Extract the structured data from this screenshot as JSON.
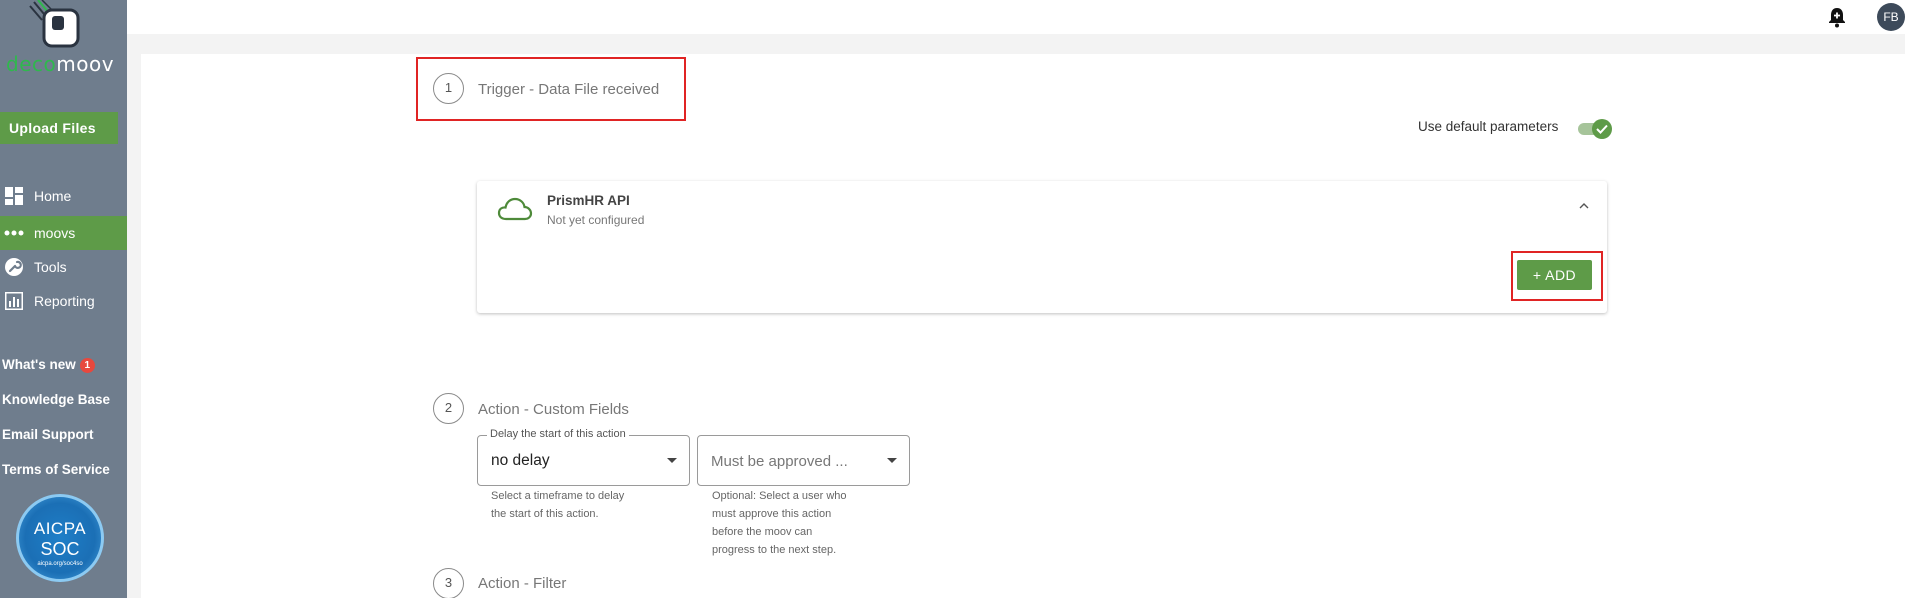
{
  "app": {
    "logo_part1": "deco",
    "logo_part2": "moov"
  },
  "sidebar": {
    "upload_label": "Upload Files",
    "nav": [
      {
        "label": "Home",
        "icon": "dashboard-icon"
      },
      {
        "label": "moovs",
        "icon": "dots-icon",
        "active": true
      },
      {
        "label": "Tools",
        "icon": "wrench-icon"
      },
      {
        "label": "Reporting",
        "icon": "bar-chart-icon"
      }
    ],
    "links": {
      "whats_new": "What's new",
      "whats_new_badge": "1",
      "knowledge_base": "Knowledge Base",
      "email_support": "Email Support",
      "terms": "Terms of Service"
    },
    "badge": {
      "line1": "AICPA",
      "line2": "SOC",
      "line3": "aicpa.org/soc4so"
    }
  },
  "topbar": {
    "avatar_initials": "FB"
  },
  "steps": [
    {
      "number": "1",
      "title": "Trigger - Data File received"
    },
    {
      "number": "2",
      "title": "Action - Custom Fields"
    },
    {
      "number": "3",
      "title": "Action - Filter"
    }
  ],
  "trigger": {
    "default_params_label": "Use default parameters",
    "default_params_on": true,
    "connector_name": "PrismHR API",
    "connector_status": "Not yet configured",
    "add_label": "+ ADD"
  },
  "custom_fields": {
    "delay_legend": "Delay the start of this action",
    "delay_value": "no delay",
    "delay_helper_1": "Select a timeframe to delay",
    "delay_helper_2": "the start of this action.",
    "approver_placeholder": "Must be approved ...",
    "approver_helper_1": "Optional: Select a user who",
    "approver_helper_2": "must approve this action",
    "approver_helper_3": "before the moov can",
    "approver_helper_4": "progress to the next step."
  },
  "colors": {
    "sidebar_bg": "#6f7d8d",
    "accent_green": "#5e9b48",
    "highlight_red": "#e02424"
  }
}
